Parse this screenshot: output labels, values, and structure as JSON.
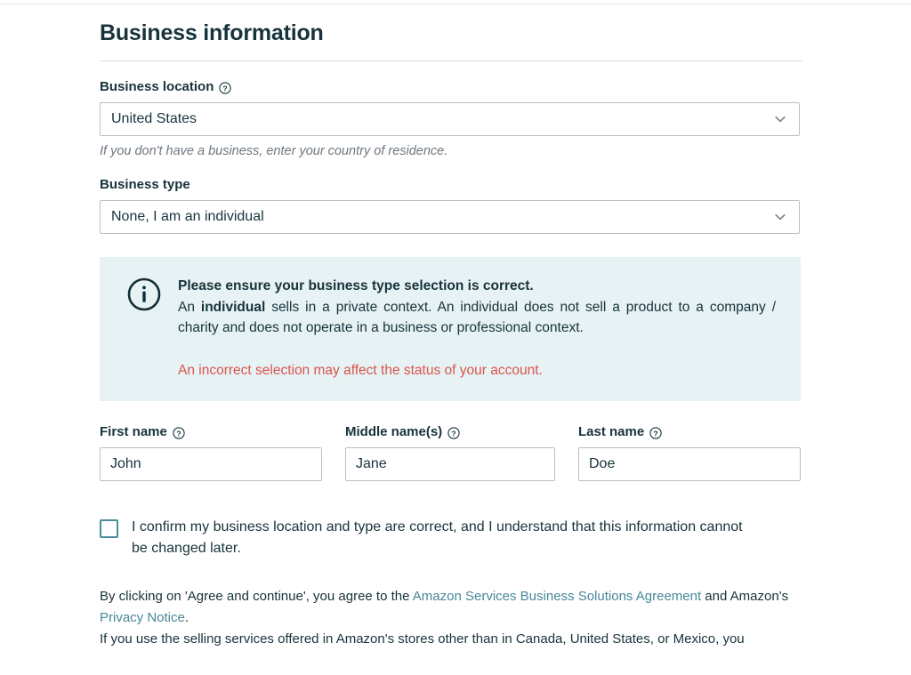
{
  "page": {
    "title": "Business information"
  },
  "business_location": {
    "label": "Business location",
    "help_icon": "question-circle-icon",
    "value": "United States",
    "hint": "If you don't have a business, enter your country of residence.",
    "chevron_icon": "chevron-down-icon"
  },
  "business_type": {
    "label": "Business type",
    "value": "None, I am an individual",
    "chevron_icon": "chevron-down-icon"
  },
  "alert": {
    "icon": "info-circle-icon",
    "title": "Please ensure your business type selection is correct.",
    "body_part1": "An ",
    "body_bold": "individual",
    "body_part2": " sells in a private context. An individual does not sell a product to a company / charity and does not operate in a business or professional context.",
    "warning": "An incorrect selection may affect the status of your account.",
    "background_color": "#e7f2f4",
    "warning_color": "#d9544e"
  },
  "names": {
    "first": {
      "label": "First name",
      "help_icon": "question-circle-icon",
      "value": "John",
      "placeholder": ""
    },
    "middle": {
      "label": "Middle name(s)",
      "help_icon": "question-circle-icon",
      "value": "Jane",
      "placeholder": ""
    },
    "last": {
      "label": "Last name",
      "help_icon": "question-circle-icon",
      "value": "Doe",
      "placeholder": ""
    }
  },
  "confirm": {
    "checked": false,
    "label": "I confirm my business location and type are correct, and I understand that this information cannot be changed later."
  },
  "legal": {
    "line1_pre": "By clicking on 'Agree and continue', you agree to the ",
    "link1": "Amazon Services Business Solutions Agreement",
    "line1_mid": " and Amazon's ",
    "link2": "Privacy Notice",
    "line1_post": ".",
    "line2": "If you use the selling services offered in Amazon's stores other than in Canada, United States, or Mexico, you",
    "link_color": "#48889a"
  }
}
